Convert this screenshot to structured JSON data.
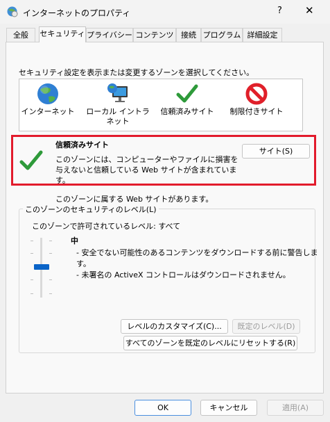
{
  "window": {
    "title": "インターネットのプロパティ",
    "help_label": "?",
    "close_label": "✕"
  },
  "tabs": [
    {
      "label": "全般",
      "active": false
    },
    {
      "label": "セキュリティ",
      "active": true
    },
    {
      "label": "プライバシー",
      "active": false
    },
    {
      "label": "コンテンツ",
      "active": false
    },
    {
      "label": "接続",
      "active": false
    },
    {
      "label": "プログラム",
      "active": false
    },
    {
      "label": "詳細設定",
      "active": false
    }
  ],
  "security": {
    "instruction": "セキュリティ設定を表示または変更するゾーンを選択してください。",
    "zones": [
      {
        "label": "インターネット",
        "icon": "globe-icon",
        "selected": false
      },
      {
        "label": "ローカル イントラネット",
        "icon": "intranet-icon",
        "selected": false
      },
      {
        "label": "信頼済みサイト",
        "icon": "checkmark-icon",
        "selected": true
      },
      {
        "label": "制限付きサイト",
        "icon": "prohibited-icon",
        "selected": false
      }
    ],
    "zone_info": {
      "name": "信頼済みサイト",
      "description": "このゾーンには、コンピューターやファイルに損害を与えないと信頼している Web サイトが含まれています。",
      "sites_button": "サイト(S)",
      "sites_note": "このゾーンに属する Web サイトがあります。"
    },
    "level_group": {
      "legend": "このゾーンのセキュリティのレベル(L)",
      "allowed_levels": "このゾーンで許可されているレベル: すべて",
      "level_name": "中",
      "level_details": [
        "- 安全でない可能性のあるコンテンツをダウンロードする前に警告します。",
        "- 未署名の ActiveX コントロールはダウンロードされません。"
      ],
      "custom_button": "レベルのカスタマイズ(C)...",
      "default_button": "既定のレベル(D)",
      "reset_all_button": "すべてのゾーンを既定のレベルにリセットする(R)"
    }
  },
  "footer": {
    "ok": "OK",
    "cancel": "キャンセル",
    "apply": "適用(A)"
  },
  "colors": {
    "selection": "#0a64c8",
    "highlight_frame": "#e21b2c",
    "check_green": "#2e9a3a"
  }
}
